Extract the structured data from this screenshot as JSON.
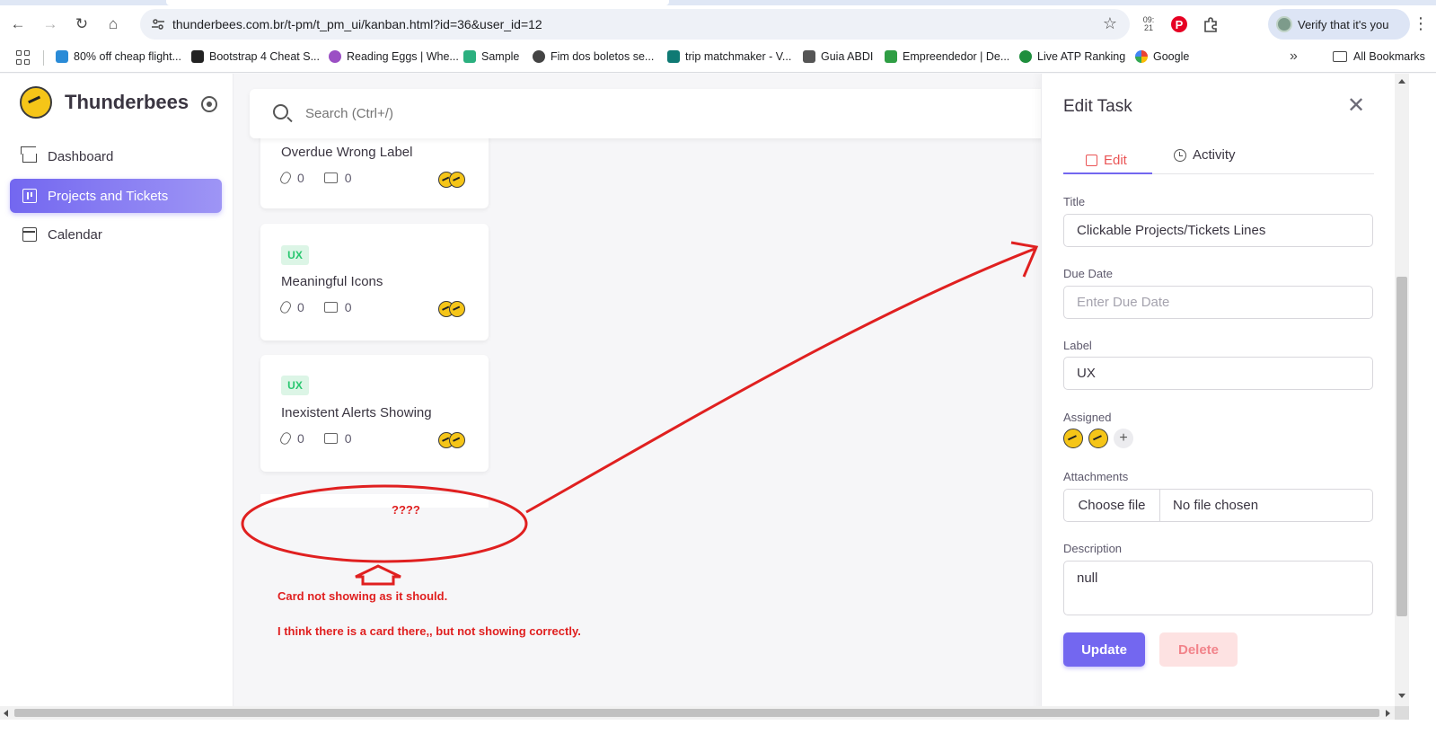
{
  "browser": {
    "url": "thunderbees.com.br/t-pm/t_pm_ui/kanban.html?id=36&user_id=12",
    "verify_label": "Verify that it's you",
    "clock_badge": "09:\n21",
    "bookmarks": [
      {
        "label": "80% off cheap flight...",
        "color": "#2a8bd7"
      },
      {
        "label": "Bootstrap 4 Cheat S...",
        "color": "#222222"
      },
      {
        "label": "Reading Eggs | Whe...",
        "color": "#9b4fc4"
      },
      {
        "label": "Sample",
        "color": "#2bb07f"
      },
      {
        "label": "Fim dos boletos se...",
        "color": "#444444"
      },
      {
        "label": "trip matchmaker - V...",
        "color": "#0f7a74"
      },
      {
        "label": "Guia ABDI",
        "color": "#555555"
      },
      {
        "label": "Empreendedor | De...",
        "color": "#2f9e44"
      },
      {
        "label": "Live ATP Ranking",
        "color": "#1f8e3d"
      },
      {
        "label": "Google",
        "color": "#4285f4"
      }
    ],
    "all_bookmarks": "All Bookmarks"
  },
  "sidebar": {
    "brand": "Thunderbees",
    "items": [
      {
        "label": "Dashboard"
      },
      {
        "label": "Projects and Tickets"
      },
      {
        "label": "Calendar"
      }
    ]
  },
  "search": {
    "placeholder": "Search (Ctrl+/)"
  },
  "cards": [
    {
      "title": "Overdue Wrong Label",
      "attachments": "0",
      "comments": "0"
    },
    {
      "badge": "UX",
      "title": "Meaningful Icons",
      "attachments": "0",
      "comments": "0"
    },
    {
      "badge": "UX",
      "title": "Inexistent Alerts Showing",
      "attachments": "0",
      "comments": "0"
    }
  ],
  "annotations": {
    "question": "????",
    "line1": "Card not showing as it should.",
    "line2": "I think there is a card there,, but not showing correctly.",
    "color": "#e02020"
  },
  "drawer": {
    "title": "Edit Task",
    "tab_edit": "Edit",
    "tab_activity": "Activity",
    "title_label": "Title",
    "title_value": "Clickable Projects/Tickets Lines",
    "due_label": "Due Date",
    "due_placeholder": "Enter Due Date",
    "label_label": "Label",
    "label_value": "UX",
    "assigned_label": "Assigned",
    "attachments_label": "Attachments",
    "choose_file": "Choose file",
    "no_file": "No file chosen",
    "description_label": "Description",
    "description_value": "null",
    "update": "Update",
    "delete": "Delete"
  },
  "colors": {
    "accent": "#7367f0",
    "badge_green": "#28c76f",
    "danger": "#ea5455"
  }
}
